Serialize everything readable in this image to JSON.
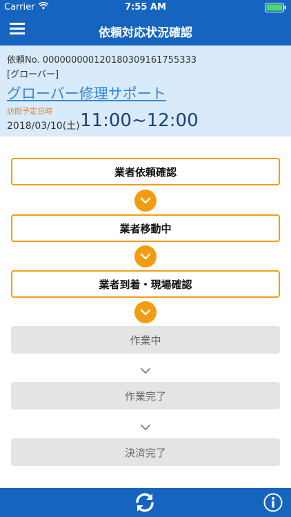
{
  "status_bar": {
    "carrier": "Carrier",
    "time": "7:55 AM"
  },
  "nav": {
    "title": "依頼対応状況確認"
  },
  "request": {
    "number": "依頼No. 00000000012018030916175533​3",
    "category": "[グローバー]",
    "company": "グローバー修理サポート",
    "visit_label": "訪問予定日時",
    "visit_date": "2018/03/10(土)",
    "visit_time": "11:00~12:00"
  },
  "steps": [
    {
      "label": "業者依頼確認",
      "state": "active"
    },
    {
      "label": "業者移動中",
      "state": "active"
    },
    {
      "label": "業者到着・現場確認",
      "state": "active"
    },
    {
      "label": "作業中",
      "state": "inactive"
    },
    {
      "label": "作業完了",
      "state": "inactive"
    },
    {
      "label": "決済完了",
      "state": "inactive"
    }
  ],
  "colors": {
    "primary": "#1565c0",
    "info_bg": "#d9eafa",
    "accent": "#f39c12",
    "link": "#2f88d8",
    "time_text": "#1a3f7a",
    "inactive_bg": "#e4e4e4"
  },
  "icons": {
    "menu": "hamburger-menu-icon",
    "refresh": "refresh-icon",
    "info": "info-icon",
    "arrow": "chevron-down-icon"
  }
}
